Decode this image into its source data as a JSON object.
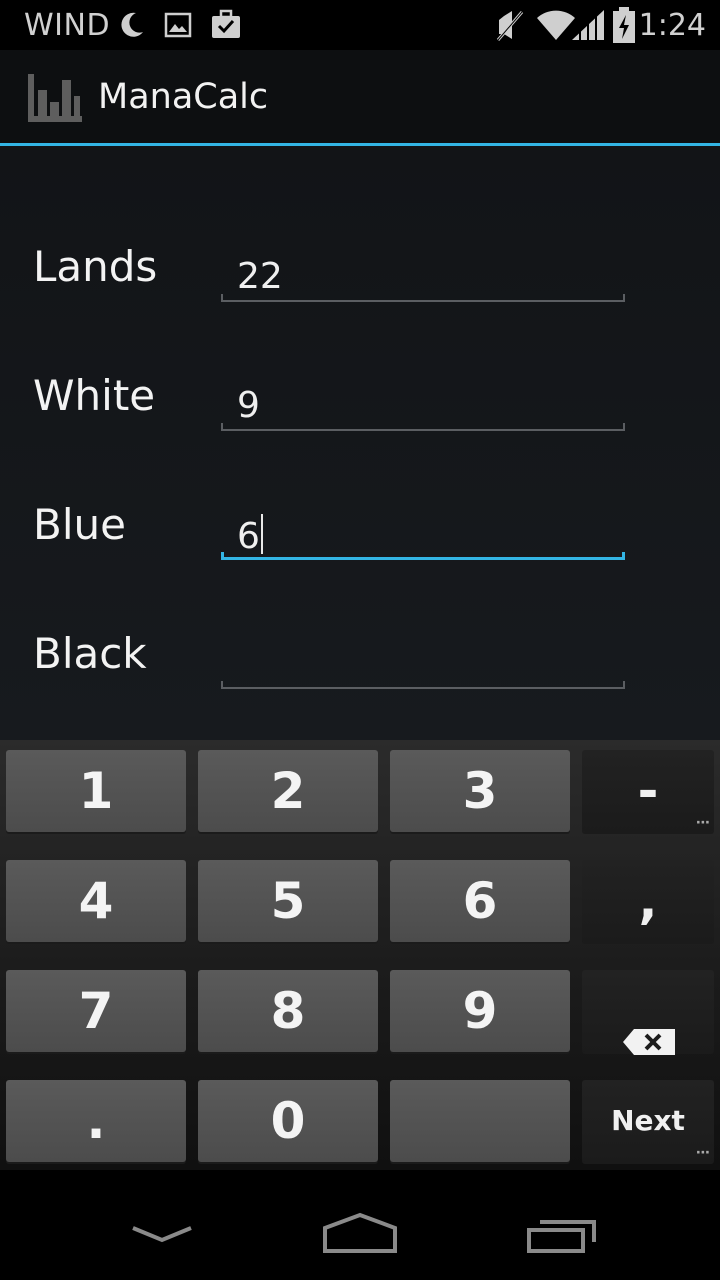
{
  "status_bar": {
    "carrier": "WIND",
    "time": "1:24",
    "icons": [
      "moon-icon",
      "image-icon",
      "briefcase-check-icon",
      "mute-icon",
      "wifi-icon",
      "signal-icon",
      "battery-charging-icon"
    ]
  },
  "action_bar": {
    "title": "ManaCalc",
    "logo_icon": "bar-chart-icon"
  },
  "form": {
    "fields": [
      {
        "label": "Lands",
        "value": "22"
      },
      {
        "label": "White",
        "value": "9"
      },
      {
        "label": "Blue",
        "value": "6"
      },
      {
        "label": "Black",
        "value": ""
      }
    ],
    "accent_color": "#33b5e5"
  },
  "keyboard": {
    "rows": [
      [
        "1",
        "2",
        "3",
        "-"
      ],
      [
        "4",
        "5",
        "6",
        ","
      ],
      [
        "7",
        "8",
        "9",
        "backspace-icon"
      ],
      [
        ".",
        "0",
        "space-icon",
        "Next"
      ]
    ],
    "next_label": "Next"
  },
  "nav_bar": {
    "icons": [
      "back-chevron-icon",
      "home-icon",
      "recents-icon"
    ]
  }
}
